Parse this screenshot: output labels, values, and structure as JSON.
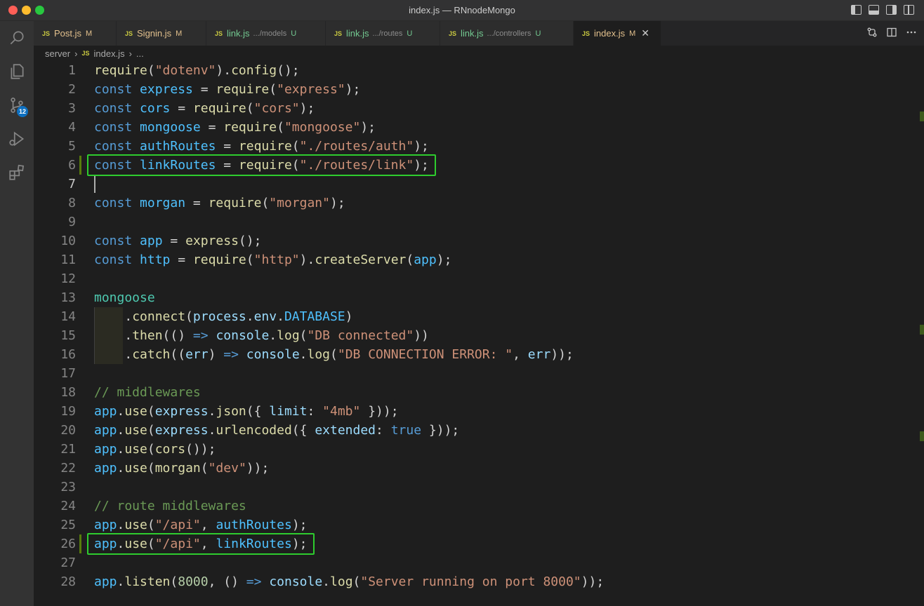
{
  "window": {
    "title": "index.js — RNnodeMongo"
  },
  "activity": {
    "scm_badge": "12"
  },
  "tabs": [
    {
      "name": "Post.js",
      "desc": "",
      "flag": "M",
      "status": "mod",
      "active": false
    },
    {
      "name": "Signin.js",
      "desc": "",
      "flag": "M",
      "status": "mod",
      "active": false
    },
    {
      "name": "link.js",
      "desc": ".../models",
      "flag": "U",
      "status": "unt",
      "active": false
    },
    {
      "name": "link.js",
      "desc": ".../routes",
      "flag": "U",
      "status": "unt",
      "active": false
    },
    {
      "name": "link.js",
      "desc": ".../controllers",
      "flag": "U",
      "status": "unt",
      "active": false
    },
    {
      "name": "index.js",
      "desc": "",
      "flag": "M",
      "status": "mod",
      "active": true
    }
  ],
  "tab_icon_label": "JS",
  "breadcrumb": {
    "folder": "server",
    "file": "index.js",
    "more": "...",
    "sep": "›"
  },
  "colors": {
    "highlight_box": "#2ecc2e",
    "keyword": "#569cd6",
    "string": "#ce9178",
    "function": "#dcdcaa",
    "comment": "#6a9955",
    "constant_var": "#4fc1ff"
  },
  "editor": {
    "current_line": 7,
    "highlighted_lines": [
      6,
      26
    ],
    "lines": [
      [
        [
          "fn",
          "require"
        ],
        [
          "pl",
          "("
        ],
        [
          "st",
          "\"dotenv\""
        ],
        [
          "pl",
          ")."
        ],
        [
          "fn",
          "config"
        ],
        [
          "pl",
          "();"
        ]
      ],
      [
        [
          "kw",
          "const "
        ],
        [
          "vr",
          "express"
        ],
        [
          "pl",
          " = "
        ],
        [
          "fn",
          "require"
        ],
        [
          "pl",
          "("
        ],
        [
          "st",
          "\"express\""
        ],
        [
          "pl",
          ");"
        ]
      ],
      [
        [
          "kw",
          "const "
        ],
        [
          "vr",
          "cors"
        ],
        [
          "pl",
          " = "
        ],
        [
          "fn",
          "require"
        ],
        [
          "pl",
          "("
        ],
        [
          "st",
          "\"cors\""
        ],
        [
          "pl",
          ");"
        ]
      ],
      [
        [
          "kw",
          "const "
        ],
        [
          "vr",
          "mongoose"
        ],
        [
          "pl",
          " = "
        ],
        [
          "fn",
          "require"
        ],
        [
          "pl",
          "("
        ],
        [
          "st",
          "\"mongoose\""
        ],
        [
          "pl",
          ");"
        ]
      ],
      [
        [
          "kw",
          "const "
        ],
        [
          "vr",
          "authRoutes"
        ],
        [
          "pl",
          " = "
        ],
        [
          "fn",
          "require"
        ],
        [
          "pl",
          "("
        ],
        [
          "st",
          "\"./routes/auth\""
        ],
        [
          "pl",
          ");"
        ]
      ],
      [
        [
          "kw",
          "const "
        ],
        [
          "vr",
          "linkRoutes"
        ],
        [
          "pl",
          " = "
        ],
        [
          "fn",
          "require"
        ],
        [
          "pl",
          "("
        ],
        [
          "st",
          "\"./routes/link\""
        ],
        [
          "pl",
          ");"
        ]
      ],
      [],
      [
        [
          "kw",
          "const "
        ],
        [
          "vr",
          "morgan"
        ],
        [
          "pl",
          " = "
        ],
        [
          "fn",
          "require"
        ],
        [
          "pl",
          "("
        ],
        [
          "st",
          "\"morgan\""
        ],
        [
          "pl",
          ");"
        ]
      ],
      [],
      [
        [
          "kw",
          "const "
        ],
        [
          "vr",
          "app"
        ],
        [
          "pl",
          " = "
        ],
        [
          "fn",
          "express"
        ],
        [
          "pl",
          "();"
        ]
      ],
      [
        [
          "kw",
          "const "
        ],
        [
          "vr",
          "http"
        ],
        [
          "pl",
          " = "
        ],
        [
          "fn",
          "require"
        ],
        [
          "pl",
          "("
        ],
        [
          "st",
          "\"http\""
        ],
        [
          "pl",
          ")."
        ],
        [
          "fn",
          "createServer"
        ],
        [
          "pl",
          "("
        ],
        [
          "vr",
          "app"
        ],
        [
          "pl",
          ");"
        ]
      ],
      [],
      [
        [
          "ty",
          "mongoose"
        ]
      ],
      [
        [
          "pl",
          "    ."
        ],
        [
          "fn",
          "connect"
        ],
        [
          "pl",
          "("
        ],
        [
          "vl",
          "process"
        ],
        [
          "pl",
          "."
        ],
        [
          "vl",
          "env"
        ],
        [
          "pl",
          "."
        ],
        [
          "vr",
          "DATABASE"
        ],
        [
          "pl",
          ")"
        ]
      ],
      [
        [
          "pl",
          "    ."
        ],
        [
          "fn",
          "then"
        ],
        [
          "pl",
          "(() "
        ],
        [
          "kw",
          "=>"
        ],
        [
          "pl",
          " "
        ],
        [
          "vl",
          "console"
        ],
        [
          "pl",
          "."
        ],
        [
          "fn",
          "log"
        ],
        [
          "pl",
          "("
        ],
        [
          "st",
          "\"DB connected\""
        ],
        [
          "pl",
          "))"
        ]
      ],
      [
        [
          "pl",
          "    ."
        ],
        [
          "fn",
          "catch"
        ],
        [
          "pl",
          "(("
        ],
        [
          "vl",
          "err"
        ],
        [
          "pl",
          ") "
        ],
        [
          "kw",
          "=>"
        ],
        [
          "pl",
          " "
        ],
        [
          "vl",
          "console"
        ],
        [
          "pl",
          "."
        ],
        [
          "fn",
          "log"
        ],
        [
          "pl",
          "("
        ],
        [
          "st",
          "\"DB CONNECTION ERROR: \""
        ],
        [
          "pl",
          ", "
        ],
        [
          "vl",
          "err"
        ],
        [
          "pl",
          "));"
        ]
      ],
      [],
      [
        [
          "cm",
          "// middlewares"
        ]
      ],
      [
        [
          "vr",
          "app"
        ],
        [
          "pl",
          "."
        ],
        [
          "fn",
          "use"
        ],
        [
          "pl",
          "("
        ],
        [
          "vl",
          "express"
        ],
        [
          "pl",
          "."
        ],
        [
          "fn",
          "json"
        ],
        [
          "pl",
          "({ "
        ],
        [
          "vl",
          "limit"
        ],
        [
          "pl",
          ": "
        ],
        [
          "st",
          "\"4mb\""
        ],
        [
          "pl",
          " }));"
        ]
      ],
      [
        [
          "vr",
          "app"
        ],
        [
          "pl",
          "."
        ],
        [
          "fn",
          "use"
        ],
        [
          "pl",
          "("
        ],
        [
          "vl",
          "express"
        ],
        [
          "pl",
          "."
        ],
        [
          "fn",
          "urlencoded"
        ],
        [
          "pl",
          "({ "
        ],
        [
          "vl",
          "extended"
        ],
        [
          "pl",
          ": "
        ],
        [
          "bo",
          "true"
        ],
        [
          "pl",
          " }));"
        ]
      ],
      [
        [
          "vr",
          "app"
        ],
        [
          "pl",
          "."
        ],
        [
          "fn",
          "use"
        ],
        [
          "pl",
          "("
        ],
        [
          "fn",
          "cors"
        ],
        [
          "pl",
          "());"
        ]
      ],
      [
        [
          "vr",
          "app"
        ],
        [
          "pl",
          "."
        ],
        [
          "fn",
          "use"
        ],
        [
          "pl",
          "("
        ],
        [
          "fn",
          "morgan"
        ],
        [
          "pl",
          "("
        ],
        [
          "st",
          "\"dev\""
        ],
        [
          "pl",
          "));"
        ]
      ],
      [],
      [
        [
          "cm",
          "// route middlewares"
        ]
      ],
      [
        [
          "vr",
          "app"
        ],
        [
          "pl",
          "."
        ],
        [
          "fn",
          "use"
        ],
        [
          "pl",
          "("
        ],
        [
          "st",
          "\"/api\""
        ],
        [
          "pl",
          ", "
        ],
        [
          "vr",
          "authRoutes"
        ],
        [
          "pl",
          ");"
        ]
      ],
      [
        [
          "vr",
          "app"
        ],
        [
          "pl",
          "."
        ],
        [
          "fn",
          "use"
        ],
        [
          "pl",
          "("
        ],
        [
          "st",
          "\"/api\""
        ],
        [
          "pl",
          ", "
        ],
        [
          "vr",
          "linkRoutes"
        ],
        [
          "pl",
          ");"
        ]
      ],
      [],
      [
        [
          "vr",
          "app"
        ],
        [
          "pl",
          "."
        ],
        [
          "fn",
          "listen"
        ],
        [
          "pl",
          "("
        ],
        [
          "nu",
          "8000"
        ],
        [
          "pl",
          ", () "
        ],
        [
          "kw",
          "=>"
        ],
        [
          "pl",
          " "
        ],
        [
          "vl",
          "console"
        ],
        [
          "pl",
          "."
        ],
        [
          "fn",
          "log"
        ],
        [
          "pl",
          "("
        ],
        [
          "st",
          "\"Server running on port 8000\""
        ],
        [
          "pl",
          "));"
        ]
      ]
    ]
  }
}
